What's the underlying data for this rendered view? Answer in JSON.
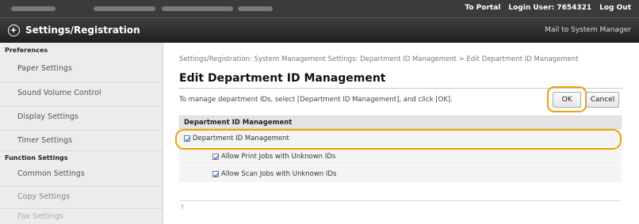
{
  "topbar": {
    "portal_link": "To Portal",
    "login_user": "Login User: 7654321",
    "logout": "Log Out"
  },
  "header": {
    "title": "Settings/Registration",
    "mail_link": "Mail to System Manager"
  },
  "sidebar": {
    "preferences_heading": "Preferences",
    "preferences_items": [
      "Paper Settings",
      "Sound Volume Control",
      "Display Settings",
      "Timer Settings"
    ],
    "function_heading": "Function Settings",
    "function_items": [
      "Common Settings",
      "Copy Settings",
      "Fax Settings"
    ]
  },
  "main": {
    "breadcrumb": "Settings/Registration: System Management Settings: Department ID Management > Edit Department ID Management",
    "title": "Edit Department ID Management",
    "description": "To manage department IDs, select [Department ID Management], and click [OK].",
    "ok_label": "OK",
    "cancel_label": "Cancel",
    "section_title": "Department ID Management",
    "options": [
      {
        "label": "Department ID Management",
        "checked": true
      },
      {
        "label": "Allow Print Jobs with Unknown IDs",
        "checked": true
      },
      {
        "label": "Allow Scan Jobs with Unknown IDs",
        "checked": true
      }
    ],
    "top_arrow": "⤒"
  },
  "colors": {
    "highlight": "#f2a000",
    "header_bg": "#2b2b2b"
  }
}
